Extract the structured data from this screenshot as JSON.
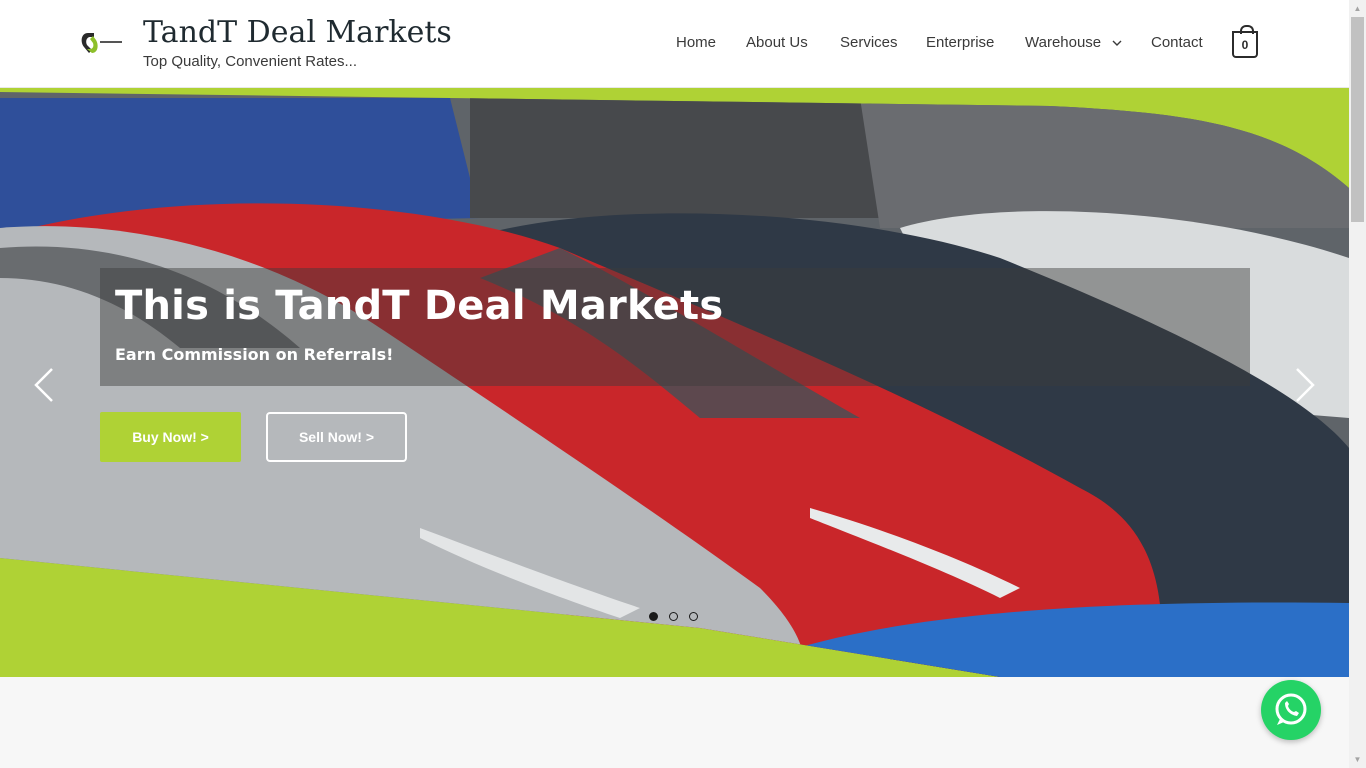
{
  "header": {
    "site_title": "TandT Deal Markets",
    "tagline": "Top Quality, Convenient Rates...",
    "logo_icon": "tandt-logo-icon"
  },
  "nav": {
    "items": [
      {
        "label": "Home"
      },
      {
        "label": "About Us"
      },
      {
        "label": "Services"
      },
      {
        "label": "Enterprise"
      },
      {
        "label": "Warehouse"
      },
      {
        "label": "Contact"
      }
    ],
    "cart_count": "0"
  },
  "hero": {
    "title": "This is TandT Deal Markets",
    "subtitle": "Earn Commission on Referrals!",
    "buy_label": "Buy Now! >",
    "sell_label": "Sell Now! >",
    "slides_total": 3,
    "active_slide": 1
  },
  "colors": {
    "accent": "#afd235",
    "whatsapp": "#25d366",
    "text_dark": "#3a3a3a"
  }
}
